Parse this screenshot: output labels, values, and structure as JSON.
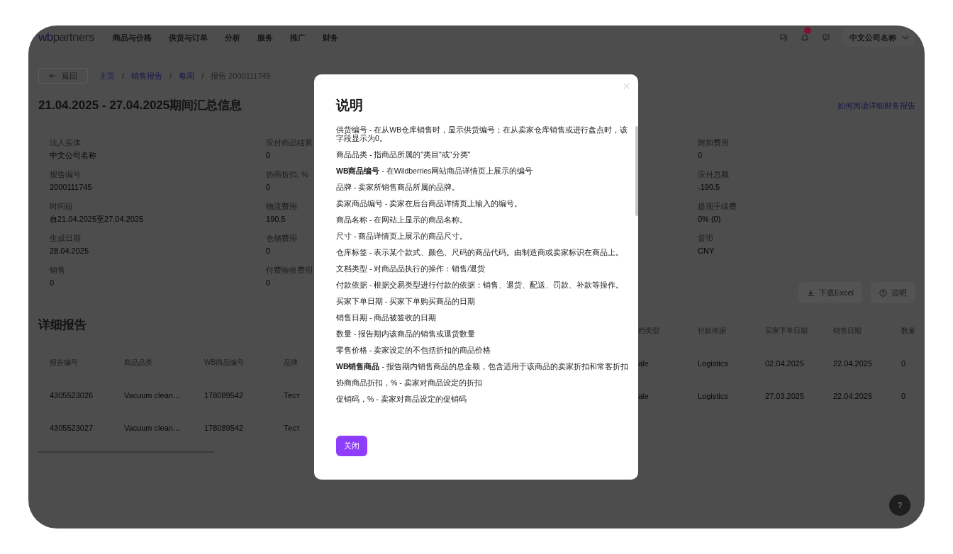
{
  "header": {
    "logo_prefix": "wb",
    "logo_suffix": "partners",
    "nav": [
      {
        "label": "商品与价格",
        "selected": false
      },
      {
        "label": "供货与订单",
        "selected": false
      },
      {
        "label": "分析",
        "selected": false
      },
      {
        "label": "服务",
        "selected": false
      },
      {
        "label": "推广",
        "selected": false
      },
      {
        "label": "财务",
        "selected": false
      }
    ],
    "notifications_badge": true,
    "company": "中文公司名称"
  },
  "breadcrumbs": {
    "back": "返回",
    "items": [
      {
        "label": "主页",
        "current": false
      },
      {
        "label": "销售报告",
        "current": false
      },
      {
        "label": "每周",
        "current": false
      },
      {
        "label": "报告 2000111745",
        "current": true
      }
    ],
    "separator": "/"
  },
  "title": "21.04.2025 - 27.04.2025期间汇总信息",
  "help_link": "如何阅读详细财务报告",
  "summary": {
    "column_1": [
      {
        "label": "法人实体",
        "value": "中文公司名称"
      },
      {
        "label": "报告编号",
        "value": "2000111745"
      },
      {
        "label": "时间段",
        "value": "自21.04.2025至27.04.2025"
      },
      {
        "label": "生成日期",
        "value": "28.04.2025"
      },
      {
        "label": "销售",
        "value": "0"
      }
    ],
    "column_2": [
      {
        "label": "应付商品结算",
        "value": "0"
      },
      {
        "label": "协商折扣, %",
        "value": "0"
      },
      {
        "label": "物流费用",
        "value": "190.5"
      },
      {
        "label": "仓储费用",
        "value": "0"
      },
      {
        "label": "付费验收费用",
        "value": "0"
      }
    ],
    "column_3": [
      {
        "label": "附加费用",
        "value": "0"
      },
      {
        "label": "应付总额",
        "value": "-190.5"
      },
      {
        "label": "提现手续费",
        "value": "0% (0)"
      },
      {
        "label": "货币",
        "value": "CNY"
      }
    ]
  },
  "detail": {
    "title": "详细报告",
    "buttons": [
      {
        "kind": "download",
        "label": "下载Excel"
      },
      {
        "kind": "help",
        "label": "说明"
      }
    ],
    "left_columns": [
      "报告编号",
      "商品品类",
      "WB商品编号",
      "品牌"
    ],
    "left_rows": [
      [
        "4305523026",
        "Vacuum clean...",
        "178089542",
        "Тест"
      ],
      [
        "4305523027",
        "Vacuum clean...",
        "178089542",
        "Тест"
      ]
    ],
    "right_columns": [
      "档类型",
      "付款依据",
      "买家下单日期",
      "销售日期",
      "数量"
    ],
    "right_rows": [
      [
        "ale",
        "Logistics",
        "02.04.2025",
        "22.04.2025",
        "0"
      ],
      [
        "ale",
        "Logistics",
        "27.03.2025",
        "22.04.2025",
        "0"
      ]
    ]
  },
  "help_button": "?",
  "modal": {
    "title": "说明",
    "paragraphs": [
      "供货编号 - 在从WB仓库销售时，显示供货编号；在从卖家仓库销售或进行盘点时，该字段显示为0。",
      "商品品类 - 指商品所属的\"类目\"或\"分类\"",
      "**WB商品编号** - 在Wildberries网站商品详情页上展示的编号",
      "品牌 - 卖家所销售商品所属的品牌。",
      "卖家商品编号 - 卖家在后台商品详情页上输入的编号。",
      "商品名称 - 在网站上显示的商品名称。",
      "尺寸 - 商品详情页上展示的商品尺寸。",
      "仓库标签 - 表示某个款式、颜色、尺码的商品代码。由制造商或卖家标识在商品上。",
      "文档类型 - 对商品品执行的操作：销售/退货",
      "付款依据 - 根据交易类型进行付款的依据：销售、退货、配送、罚款、补款等操作。",
      "买家下单日期 - 买家下单购买商品的日期",
      "销售日期 - 商品被签收的日期",
      "数量 - 报告期内该商品的销售或退货数量",
      "零售价格 - 卖家设定的不包括折扣的商品价格",
      "**WB销售商品** - 报告期内销售商品的总金额，包含适用于该商品的卖家折扣和常客折扣",
      "协商商品折扣，% - 卖家对商品设定的折扣",
      "促销码，% - 卖家对商品设定的促销码"
    ],
    "close_button": "关闭"
  }
}
